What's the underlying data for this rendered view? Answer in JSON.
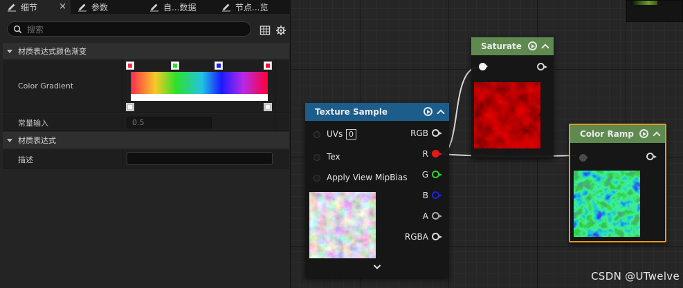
{
  "tabs": [
    {
      "label": "细节",
      "active": true,
      "closable": true
    },
    {
      "label": "参数",
      "active": false
    },
    {
      "label": "自...数据",
      "active": false
    },
    {
      "label": "节点...览",
      "active": false
    }
  ],
  "search": {
    "placeholder": "搜索"
  },
  "categories": {
    "gradient": "材质表达式颜色渐变",
    "expression": "材质表达式"
  },
  "properties": {
    "color_gradient_label": "Color Gradient",
    "constant_input_label": "常量输入",
    "constant_input_value": "0.5",
    "description_label": "描述",
    "description_value": ""
  },
  "gradient_stops": {
    "top": [
      "#ff2a4e",
      "#2ee02a",
      "#1a1aff",
      "#ff0033"
    ],
    "bottom": [
      "#f4f4f4",
      "#f4f4f4"
    ]
  },
  "nodes": {
    "saturate": {
      "title": "Saturate",
      "header_color": "#5e8a4f"
    },
    "texture_sample": {
      "title": "Texture Sample",
      "header_color": "#1c5d8b",
      "inputs": [
        "UVs",
        "Tex",
        "Apply View MipBias"
      ],
      "uv_value": "0",
      "outputs": [
        "RGB",
        "R",
        "G",
        "B",
        "A",
        "RGBA"
      ],
      "output_colors": [
        "#d8d8d8",
        "#e8161b",
        "#2bd42b",
        "#2020d8",
        "#a8a8a8",
        "#d8d8d8"
      ]
    },
    "color_ramp": {
      "title": "Color Ramp",
      "header_color": "#5e8a4f",
      "border_color": "#e79a1e"
    }
  },
  "watermark": "CSDN @UTwelve",
  "colors": {
    "panel_bg": "#242424",
    "graph_bg": "#262626",
    "wire": "#d8d8d8"
  }
}
